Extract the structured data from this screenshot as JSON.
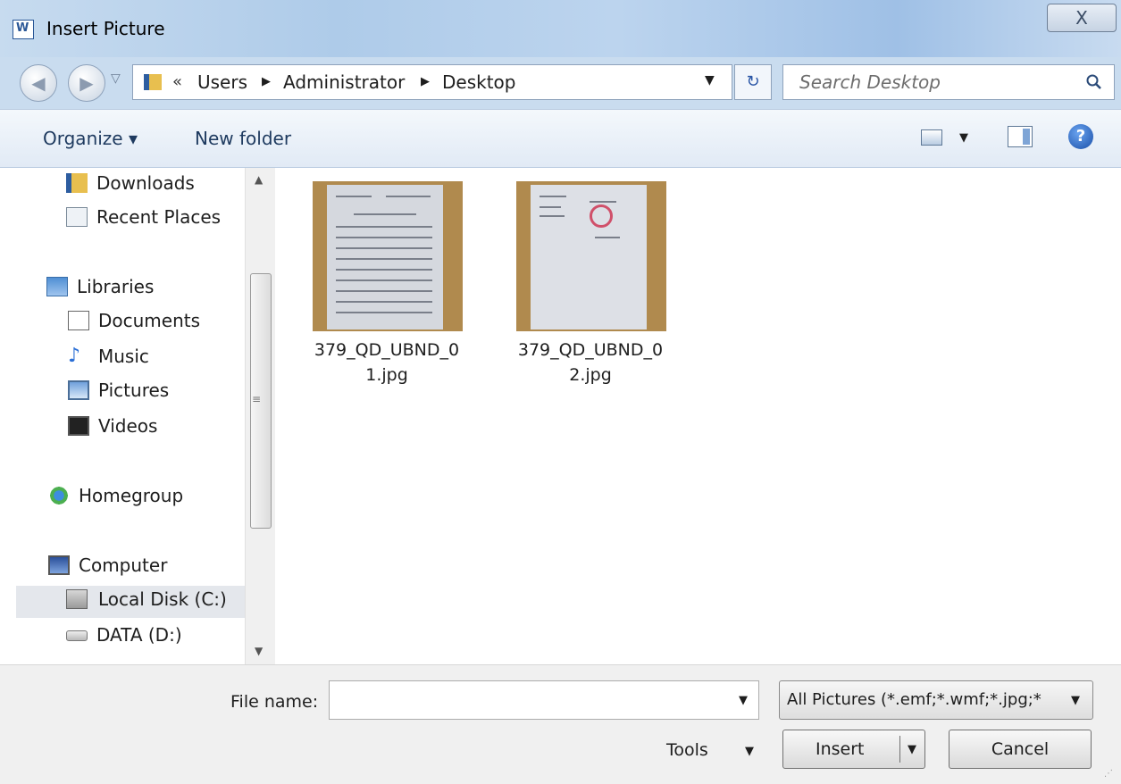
{
  "window": {
    "title": "Insert Picture",
    "close_label": "X"
  },
  "navbar": {
    "back_label": "◀",
    "forward_label": "▶",
    "breadcrumbs": [
      "Users",
      "Administrator",
      "Desktop"
    ],
    "overflow_label": "«",
    "search_placeholder": "Search Desktop"
  },
  "toolbar": {
    "organize_label": "Organize ▾",
    "new_folder_label": "New folder",
    "help_label": "?"
  },
  "sidebar": {
    "items": [
      {
        "label": "Downloads",
        "icon": "downloads-icon"
      },
      {
        "label": "Recent Places",
        "icon": "recent-places-icon"
      },
      {
        "label": "Libraries",
        "icon": "libraries-icon"
      },
      {
        "label": "Documents",
        "icon": "documents-icon"
      },
      {
        "label": "Music",
        "icon": "music-icon"
      },
      {
        "label": "Pictures",
        "icon": "pictures-icon"
      },
      {
        "label": "Videos",
        "icon": "videos-icon"
      },
      {
        "label": "Homegroup",
        "icon": "homegroup-icon"
      },
      {
        "label": "Computer",
        "icon": "computer-icon"
      },
      {
        "label": "Local Disk (C:)",
        "icon": "local-disk-icon",
        "selected": true
      },
      {
        "label": "DATA (D:)",
        "icon": "drive-icon"
      }
    ]
  },
  "files": [
    {
      "name_line1": "379_QD_UBND_0",
      "name_line2": "1.jpg"
    },
    {
      "name_line1": "379_QD_UBND_0",
      "name_line2": "2.jpg"
    }
  ],
  "footer": {
    "file_name_label": "File name:",
    "file_name_value": "",
    "filter_value": "All Pictures (*.emf;*.wmf;*.jpg;*",
    "tools_label": "Tools",
    "insert_label": "Insert",
    "cancel_label": "Cancel"
  }
}
